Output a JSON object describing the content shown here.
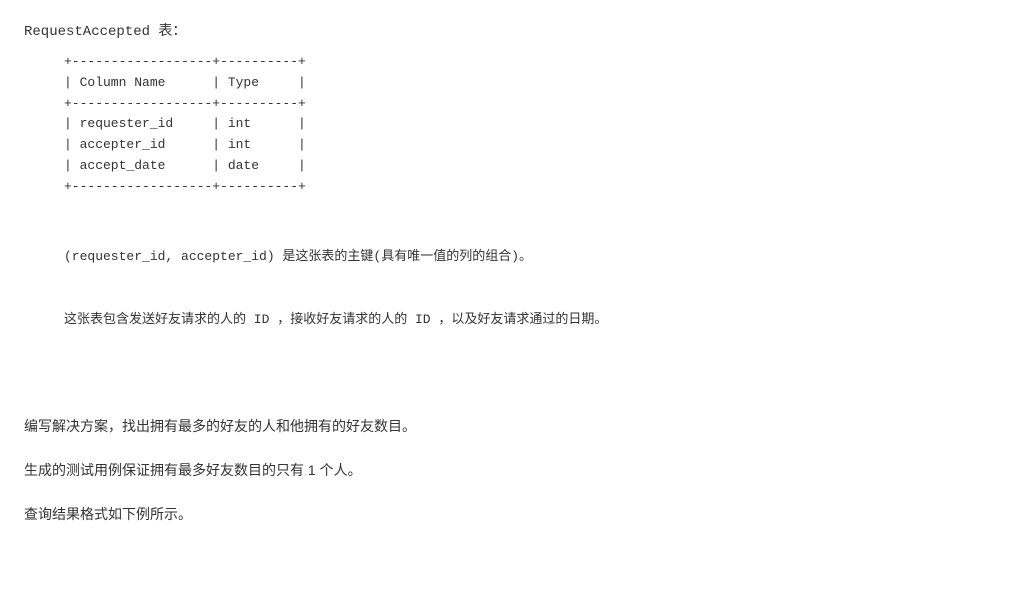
{
  "title": {
    "text": "RequestAccepted 表："
  },
  "table": {
    "border_top": "+------------------+----------+",
    "header_row": "| Column Name      | Type     |",
    "border_middle": "+------------------+----------+",
    "row1": "| requester_id     | int      |",
    "row2": "| accepter_id      | int      |",
    "row3": "| accept_date      | date     |",
    "border_bottom": "+------------------+----------+"
  },
  "notes": {
    "line1": "(requester_id, accepter_id) 是这张表的主键(具有唯一值的列的组合)。",
    "line2": "这张表包含发送好友请求的人的 ID ，接收好友请求的人的 ID ，以及好友请求通过的日期。"
  },
  "description": {
    "para1": "编写解决方案，找出拥有最多的好友的人和他拥有的好友数目。",
    "para2": "生成的测试用例保证拥有最多好友数目的只有 1 个人。",
    "para3": "查询结果格式如下例所示。"
  }
}
